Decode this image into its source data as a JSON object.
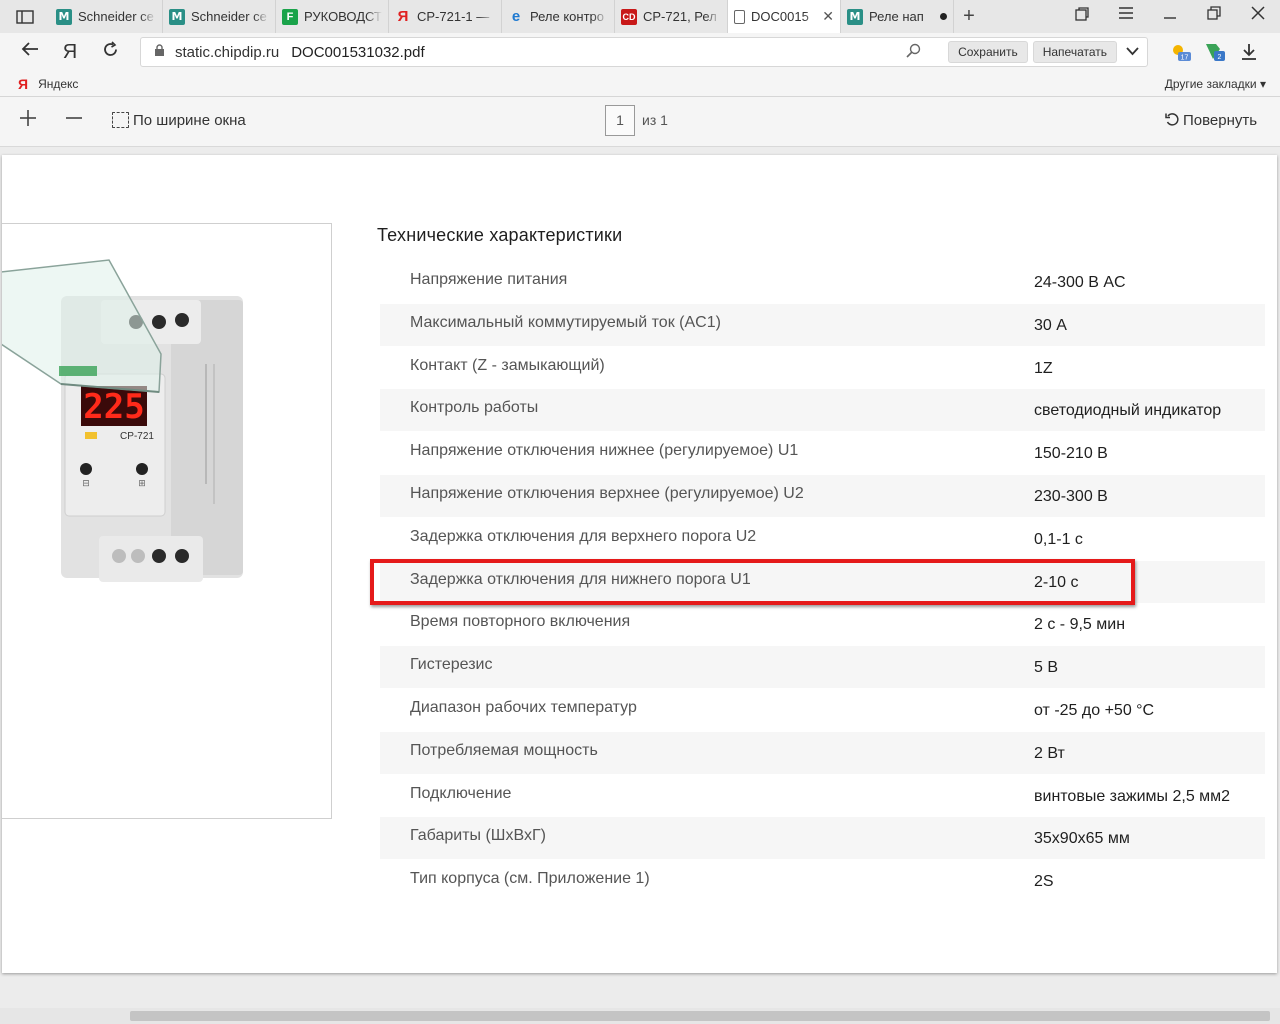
{
  "tabs": [
    {
      "title": "Schneider ce",
      "favicon": "M",
      "kind": "m"
    },
    {
      "title": "Schneider ce",
      "favicon": "M",
      "kind": "m"
    },
    {
      "title": "РУКОВОДСТ",
      "favicon": "F",
      "kind": "f"
    },
    {
      "title": "CP-721-1 —",
      "favicon": "Я",
      "kind": "y"
    },
    {
      "title": "Реле контро",
      "favicon": "e",
      "kind": "e"
    },
    {
      "title": "CP-721, Рел",
      "favicon": "CD",
      "kind": "c"
    },
    {
      "title": "DOC0015",
      "favicon": "",
      "kind": "d",
      "active": true
    },
    {
      "title": "Реле нап",
      "favicon": "M",
      "kind": "m",
      "unsaved": true
    }
  ],
  "address": {
    "host": "static.chipdip.ru",
    "path": "DOC001531032.pdf",
    "save_label": "Сохранить",
    "print_label": "Напечатать"
  },
  "bookmarks": {
    "yandex_label": "Яндекс",
    "other_label": "Другие закладки ▾"
  },
  "pdf_toolbar": {
    "fit_label": "По ширине окна",
    "page_current": "1",
    "page_of": "из 1",
    "rotate_label": "Повернуть"
  },
  "document": {
    "heading": "Технические характеристики",
    "specs": [
      {
        "label": "Напряжение питания",
        "value": "24-300 В AC"
      },
      {
        "label": "Максимальный коммутируемый ток (AC1)",
        "value": "30 А"
      },
      {
        "label": "Контакт (Z - замыкающий)",
        "value": "1Z"
      },
      {
        "label": "Контроль работы",
        "value": "светодиодный индикатор"
      },
      {
        "label": "Напряжение отключения нижнее (регулируемое) U1",
        "value": "150-210 В"
      },
      {
        "label": "Напряжение отключения верхнее (регулируемое) U2",
        "value": "230-300 В"
      },
      {
        "label": "Задержка отключения для верхнего порога U2",
        "value": "0,1-1 с"
      },
      {
        "label": "Задержка отключения для нижнего порога U1",
        "value": "2-10 с"
      },
      {
        "label": "Время повторного включения",
        "value": "2 с - 9,5 мин"
      },
      {
        "label": "Гистерезис",
        "value": "5 В"
      },
      {
        "label": "Диапазон рабочих температур",
        "value": "от -25 до +50 °С"
      },
      {
        "label": "Потребляемая мощность",
        "value": "2 Вт"
      },
      {
        "label": "Подключение",
        "value": "винтовые зажимы 2,5 мм2"
      },
      {
        "label": "Габариты (ШхВхГ)",
        "value": "35х90х65 мм"
      },
      {
        "label": "Тип корпуса (см. Приложение 1)",
        "value": "2S"
      }
    ],
    "device": {
      "display_reading": "225",
      "model": "CP-721",
      "minus": "⊟",
      "plus": "⊞"
    }
  },
  "colors": {
    "highlight": "#e51a1a",
    "display_digits": "#ff2a1a",
    "row_alt": "#f6f6f6"
  }
}
